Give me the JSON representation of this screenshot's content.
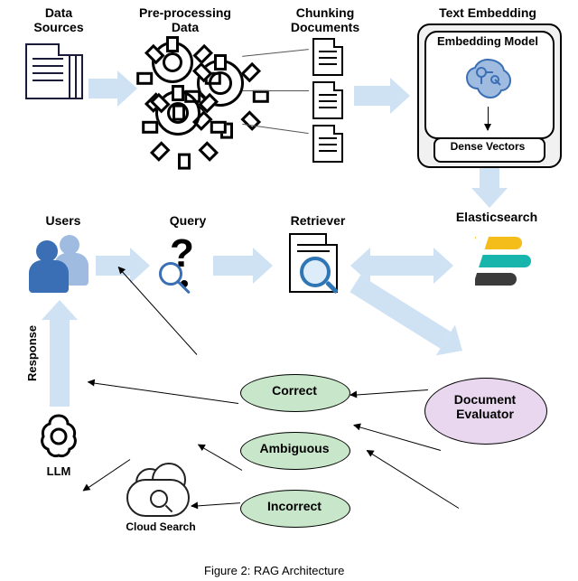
{
  "diagram": {
    "caption": "Figure 2: RAG Architecture",
    "top_row": {
      "data_sources": "Data\nSources",
      "preprocessing": "Pre-processing\nData",
      "chunking": "Chunking\nDocuments",
      "text_embedding_title": "Text Embedding",
      "embedding_model": "Embedding Model",
      "dense_vectors": "Dense Vectors"
    },
    "mid_row": {
      "users": "Users",
      "query": "Query",
      "retriever": "Retriever",
      "elasticsearch": "Elasticsearch"
    },
    "bottom": {
      "response": "Response",
      "llm": "LLM",
      "doc_evaluator": "Document\nEvaluator",
      "correct": "Correct",
      "ambiguous": "Ambiguous",
      "incorrect": "Incorrect",
      "cloud_search": "Cloud Search"
    }
  }
}
